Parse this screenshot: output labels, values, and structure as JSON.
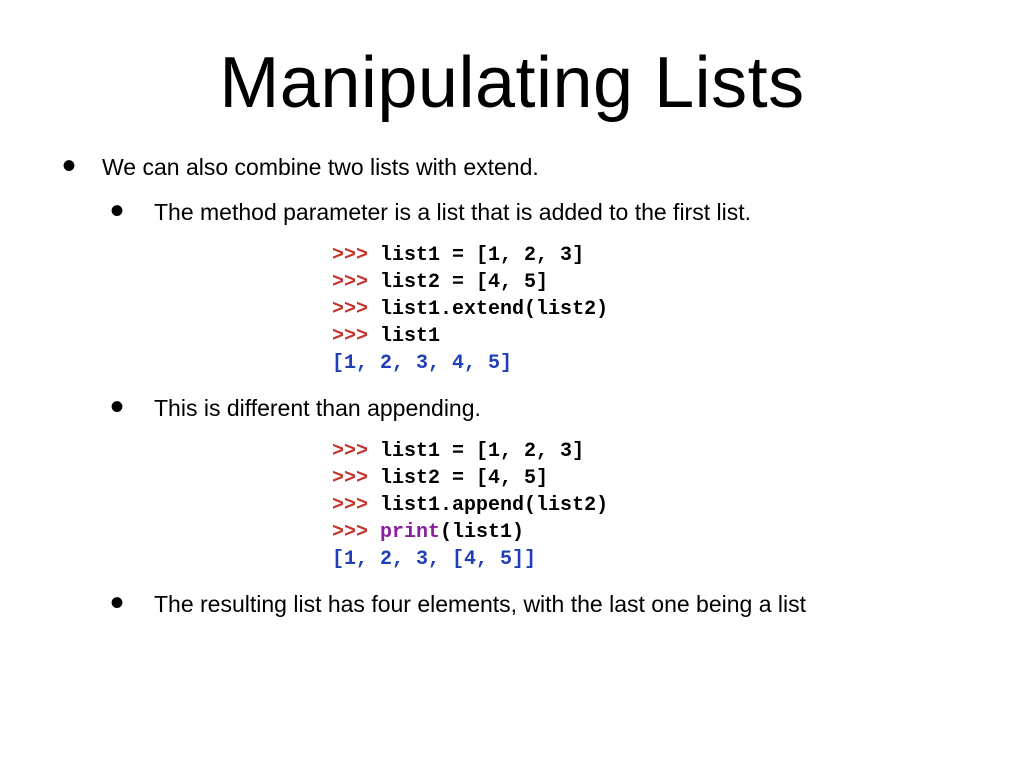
{
  "title": "Manipulating Lists",
  "bullets": {
    "main": "We can also combine two lists with extend.",
    "sub1": "The method parameter is a list that is added to the first list.",
    "sub2": "This is different than appending.",
    "sub3": "The resulting list has four elements, with the last one being a list"
  },
  "code": {
    "prompt": ">>>",
    "block1": {
      "line1": "list1 = [1, 2, 3]",
      "line2": "list2 = [4, 5]",
      "line3": "list1.extend(list2)",
      "line4": "list1",
      "out": "[1, 2, 3, 4, 5]"
    },
    "block2": {
      "line1": "list1 = [1, 2, 3]",
      "line2": "list2 = [4, 5]",
      "line3": "list1.append(list2)",
      "line4_pre": "(list1)",
      "print_kw": "print",
      "out": "[1, 2, 3, [4, 5]]"
    }
  }
}
